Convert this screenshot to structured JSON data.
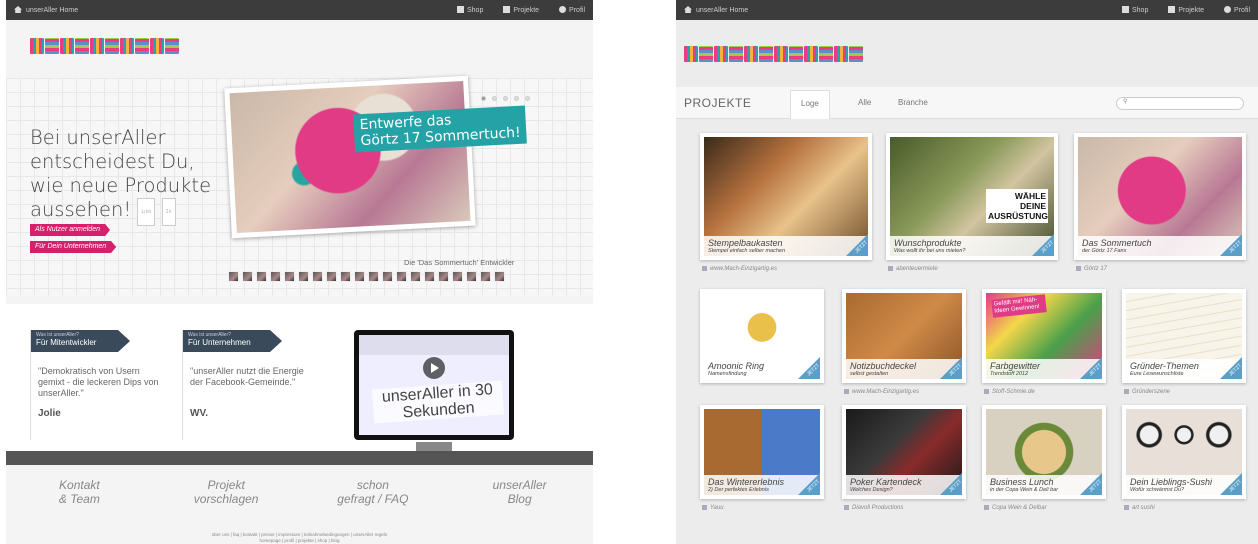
{
  "left": {
    "topbar": {
      "home": "unserAller Home",
      "shop": "Shop",
      "projekte": "Projekte",
      "profil": "Profil"
    },
    "hero": {
      "headline": "Bei unserAller entscheidest Du, wie neue Produkte aussehen!",
      "like": "Like",
      "like_count": "2k",
      "btn_user": "Als Nutzer anmelden",
      "btn_company": "Für Dein Unternehmen",
      "teal_label_1": "Entwerfe das",
      "teal_label_2": "Görtz 17 Sommertuch!",
      "devs_label": "Die 'Das Sommertuch' Entwickler"
    },
    "section2": {
      "tag1_small": "Was ist unserAller?",
      "tag1_big": "Für Mitentwickler",
      "quote1": "\"Demokratisch von Usern gemixt - die leckeren Dips von unserAller.\"",
      "sig1": "Jolie",
      "tag2_small": "Was ist unserAller?",
      "tag2_big": "Für Unternehmen",
      "quote2": "\"unserAller nutzt die Energie der Facebook-Gemeinde.\"",
      "sig2": "WV.",
      "video_text": "unserAller in 30 Sekunden"
    },
    "footer": {
      "link1": "Kontakt\n& Team",
      "link2": "Projekt\nvorschlagen",
      "link3": "schon\ngefragt / FAQ",
      "link4": "unserAller\nBlog",
      "small1": "über uns | faq | kontakt | presse | impressum | teilnahmebedingungen | unserAller regeln",
      "small2": "homepage | profil | projekte | shop | blog"
    }
  },
  "right": {
    "topbar": {
      "home": "unserAller Home",
      "shop": "Shop",
      "projekte": "Projekte",
      "profil": "Profil"
    },
    "projbar": {
      "title": "PROJEKTE",
      "tab1": "Loge",
      "tab2": "Alle",
      "tab3": "Branche"
    },
    "ribbon": "JETZT",
    "cards": [
      {
        "title": "Stempelbaukasten",
        "sub": "Stempel einfach selber machen",
        "source": "www.Mach-Einzigartig.es"
      },
      {
        "title": "Wunschprodukte",
        "sub": "Was wollt ihr bei uns mieten?",
        "source": "abenteuermiete",
        "overlay": "WÄHLE DEINE AUSRÜSTUNG"
      },
      {
        "title": "Das Sommertuch",
        "sub": "der Görtz 17 Fans",
        "source": "Görtz 17"
      },
      {
        "title": "Amoonic Ring",
        "sub": "Namensfindung",
        "source": ""
      },
      {
        "title": "Notizbuchdeckel",
        "sub": "selbst gestalten",
        "source": "www.Mach-Einzigartig.es"
      },
      {
        "title": "Farbgewitter",
        "sub": "Trendstoff 2012",
        "source": "Stoff-Schmie.de",
        "overlay": "Gefällt mir! Näh-Ideen Gewinnen!"
      },
      {
        "title": "Gründer-Themen",
        "sub": "Eure Lesewunschliste",
        "source": "Gründerszene"
      },
      {
        "title": "Das Wintererlebnis",
        "sub": "2) Der perfektes Erlebnis",
        "source": "Yauu"
      },
      {
        "title": "Poker Kartendeck",
        "sub": "Welches Design?",
        "source": "Diavoli Productions"
      },
      {
        "title": "Business Lunch",
        "sub": "in der Copa Wein & Deli bar",
        "source": "Copa Wein & Delbar"
      },
      {
        "title": "Dein Lieblings-Sushi",
        "sub": "Wofür schwärmst Du?",
        "source": "art sushi"
      }
    ]
  }
}
